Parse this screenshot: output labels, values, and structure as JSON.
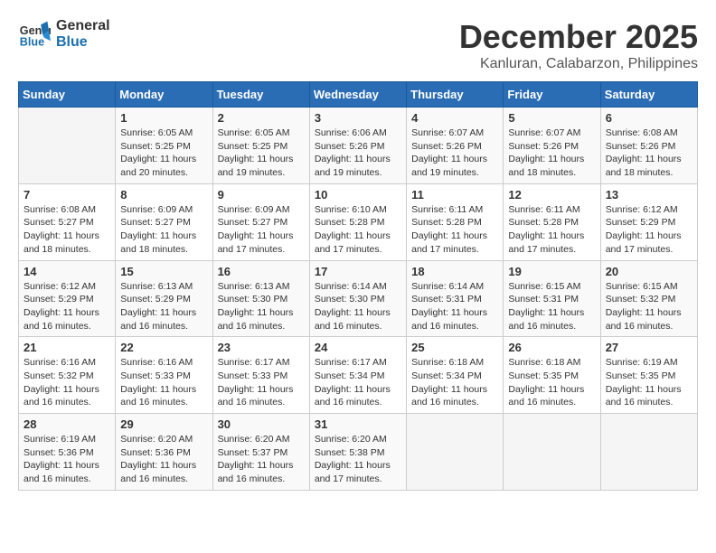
{
  "logo": {
    "line1": "General",
    "line2": "Blue"
  },
  "title": "December 2025",
  "location": "Kanluran, Calabarzon, Philippines",
  "weekdays": [
    "Sunday",
    "Monday",
    "Tuesday",
    "Wednesday",
    "Thursday",
    "Friday",
    "Saturday"
  ],
  "weeks": [
    [
      {
        "day": "",
        "info": ""
      },
      {
        "day": "1",
        "info": "Sunrise: 6:05 AM\nSunset: 5:25 PM\nDaylight: 11 hours\nand 20 minutes."
      },
      {
        "day": "2",
        "info": "Sunrise: 6:05 AM\nSunset: 5:25 PM\nDaylight: 11 hours\nand 19 minutes."
      },
      {
        "day": "3",
        "info": "Sunrise: 6:06 AM\nSunset: 5:26 PM\nDaylight: 11 hours\nand 19 minutes."
      },
      {
        "day": "4",
        "info": "Sunrise: 6:07 AM\nSunset: 5:26 PM\nDaylight: 11 hours\nand 19 minutes."
      },
      {
        "day": "5",
        "info": "Sunrise: 6:07 AM\nSunset: 5:26 PM\nDaylight: 11 hours\nand 18 minutes."
      },
      {
        "day": "6",
        "info": "Sunrise: 6:08 AM\nSunset: 5:26 PM\nDaylight: 11 hours\nand 18 minutes."
      }
    ],
    [
      {
        "day": "7",
        "info": "Sunrise: 6:08 AM\nSunset: 5:27 PM\nDaylight: 11 hours\nand 18 minutes."
      },
      {
        "day": "8",
        "info": "Sunrise: 6:09 AM\nSunset: 5:27 PM\nDaylight: 11 hours\nand 18 minutes."
      },
      {
        "day": "9",
        "info": "Sunrise: 6:09 AM\nSunset: 5:27 PM\nDaylight: 11 hours\nand 17 minutes."
      },
      {
        "day": "10",
        "info": "Sunrise: 6:10 AM\nSunset: 5:28 PM\nDaylight: 11 hours\nand 17 minutes."
      },
      {
        "day": "11",
        "info": "Sunrise: 6:11 AM\nSunset: 5:28 PM\nDaylight: 11 hours\nand 17 minutes."
      },
      {
        "day": "12",
        "info": "Sunrise: 6:11 AM\nSunset: 5:28 PM\nDaylight: 11 hours\nand 17 minutes."
      },
      {
        "day": "13",
        "info": "Sunrise: 6:12 AM\nSunset: 5:29 PM\nDaylight: 11 hours\nand 17 minutes."
      }
    ],
    [
      {
        "day": "14",
        "info": "Sunrise: 6:12 AM\nSunset: 5:29 PM\nDaylight: 11 hours\nand 16 minutes."
      },
      {
        "day": "15",
        "info": "Sunrise: 6:13 AM\nSunset: 5:29 PM\nDaylight: 11 hours\nand 16 minutes."
      },
      {
        "day": "16",
        "info": "Sunrise: 6:13 AM\nSunset: 5:30 PM\nDaylight: 11 hours\nand 16 minutes."
      },
      {
        "day": "17",
        "info": "Sunrise: 6:14 AM\nSunset: 5:30 PM\nDaylight: 11 hours\nand 16 minutes."
      },
      {
        "day": "18",
        "info": "Sunrise: 6:14 AM\nSunset: 5:31 PM\nDaylight: 11 hours\nand 16 minutes."
      },
      {
        "day": "19",
        "info": "Sunrise: 6:15 AM\nSunset: 5:31 PM\nDaylight: 11 hours\nand 16 minutes."
      },
      {
        "day": "20",
        "info": "Sunrise: 6:15 AM\nSunset: 5:32 PM\nDaylight: 11 hours\nand 16 minutes."
      }
    ],
    [
      {
        "day": "21",
        "info": "Sunrise: 6:16 AM\nSunset: 5:32 PM\nDaylight: 11 hours\nand 16 minutes."
      },
      {
        "day": "22",
        "info": "Sunrise: 6:16 AM\nSunset: 5:33 PM\nDaylight: 11 hours\nand 16 minutes."
      },
      {
        "day": "23",
        "info": "Sunrise: 6:17 AM\nSunset: 5:33 PM\nDaylight: 11 hours\nand 16 minutes."
      },
      {
        "day": "24",
        "info": "Sunrise: 6:17 AM\nSunset: 5:34 PM\nDaylight: 11 hours\nand 16 minutes."
      },
      {
        "day": "25",
        "info": "Sunrise: 6:18 AM\nSunset: 5:34 PM\nDaylight: 11 hours\nand 16 minutes."
      },
      {
        "day": "26",
        "info": "Sunrise: 6:18 AM\nSunset: 5:35 PM\nDaylight: 11 hours\nand 16 minutes."
      },
      {
        "day": "27",
        "info": "Sunrise: 6:19 AM\nSunset: 5:35 PM\nDaylight: 11 hours\nand 16 minutes."
      }
    ],
    [
      {
        "day": "28",
        "info": "Sunrise: 6:19 AM\nSunset: 5:36 PM\nDaylight: 11 hours\nand 16 minutes."
      },
      {
        "day": "29",
        "info": "Sunrise: 6:20 AM\nSunset: 5:36 PM\nDaylight: 11 hours\nand 16 minutes."
      },
      {
        "day": "30",
        "info": "Sunrise: 6:20 AM\nSunset: 5:37 PM\nDaylight: 11 hours\nand 16 minutes."
      },
      {
        "day": "31",
        "info": "Sunrise: 6:20 AM\nSunset: 5:38 PM\nDaylight: 11 hours\nand 17 minutes."
      },
      {
        "day": "",
        "info": ""
      },
      {
        "day": "",
        "info": ""
      },
      {
        "day": "",
        "info": ""
      }
    ]
  ]
}
